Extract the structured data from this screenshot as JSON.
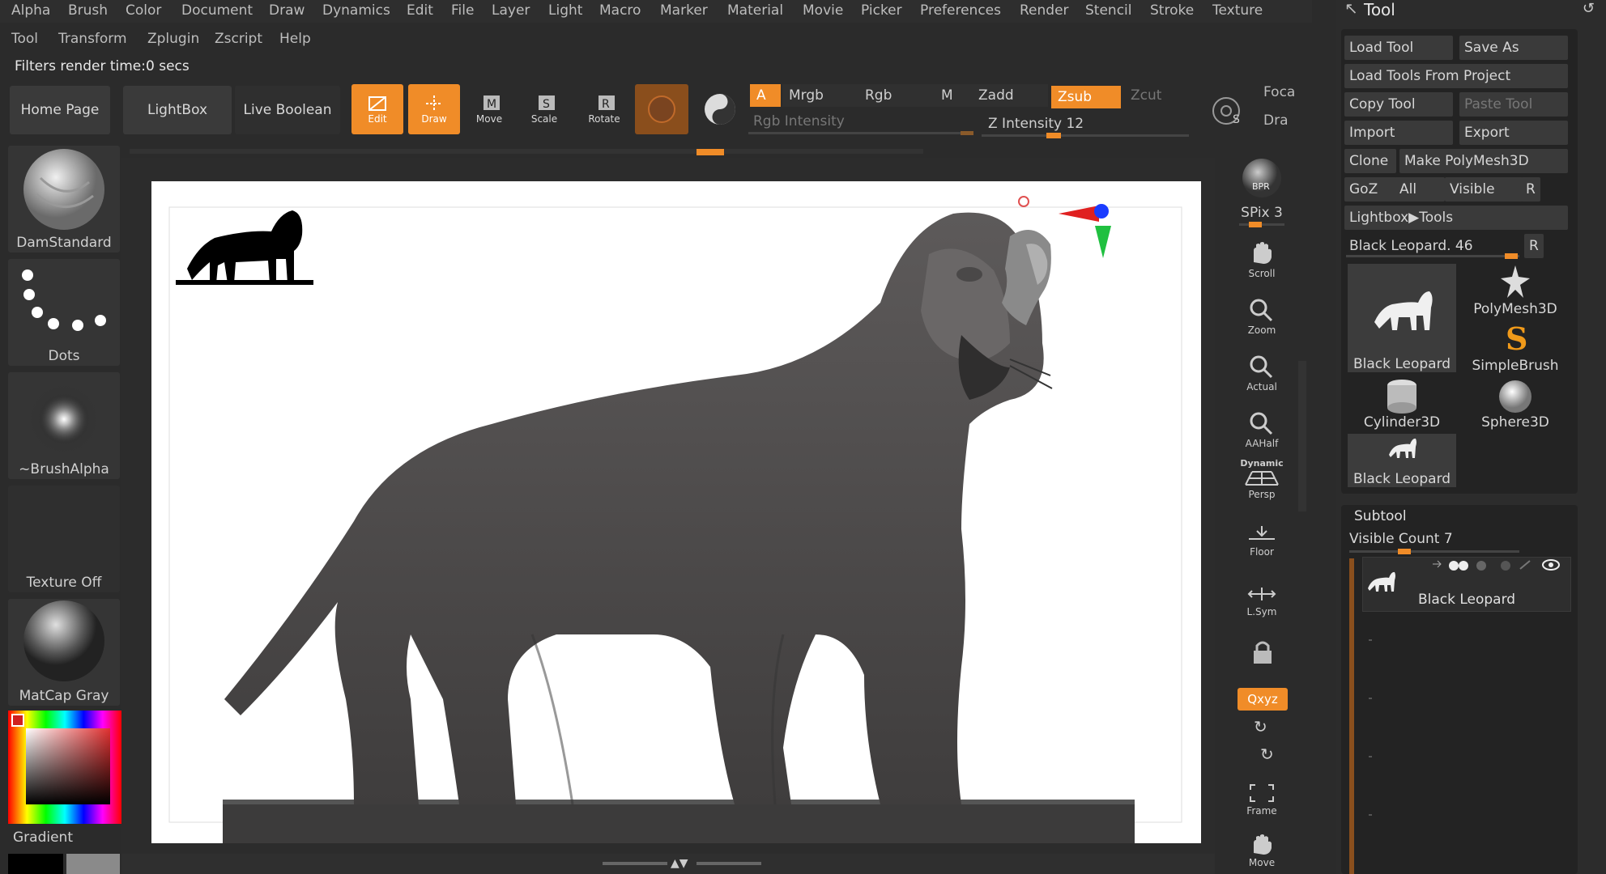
{
  "menu_primary": [
    "Alpha",
    "Brush",
    "Color",
    "Document",
    "Draw",
    "Dynamics",
    "Edit",
    "File",
    "Layer",
    "Light",
    "Macro",
    "Marker",
    "Material",
    "Movie",
    "Picker",
    "Preferences",
    "Render",
    "Stencil",
    "Stroke",
    "Texture"
  ],
  "menu_secondary": [
    "Tool",
    "Transform",
    "Zplugin",
    "Zscript",
    "Help"
  ],
  "status_text": "Filters render time:0 secs",
  "toolbar": {
    "home_page": "Home Page",
    "lightbox": "LightBox",
    "live_boolean": "Live Boolean",
    "edit": "Edit",
    "draw": "Draw",
    "move": "Move",
    "scale": "Scale",
    "rotate": "Rotate",
    "a": "A",
    "mrgb": "Mrgb",
    "rgb": "Rgb",
    "m": "M",
    "zadd": "Zadd",
    "zsub": "Zsub",
    "zcut": "Zcut",
    "rgb_intensity": "Rgb Intensity",
    "z_intensity": "Z Intensity 12",
    "focal": "Foca",
    "draw_size": "Dra",
    "accent": "#f08c28"
  },
  "left_shelf": {
    "brush": "DamStandard",
    "stroke": "Dots",
    "alpha": "~BrushAlpha",
    "texture": "Texture Off",
    "material": "MatCap Gray",
    "gradient": "Gradient"
  },
  "right_bar": {
    "bpr": "BPR",
    "spix": "SPix 3",
    "scroll": "Scroll",
    "zoom": "Zoom",
    "actual": "Actual",
    "aahalf": "AAHalf",
    "dynamic": "Dynamic",
    "persp": "Persp",
    "floor": "Floor",
    "lsym": "L.Sym",
    "xyz": "Qxyz",
    "frame": "Frame",
    "move": "Move"
  },
  "tool_panel": {
    "title": "Tool",
    "load_tool": "Load Tool",
    "save_as": "Save As",
    "load_from_project": "Load Tools From Project",
    "copy_tool": "Copy Tool",
    "paste_tool": "Paste Tool",
    "import": "Import",
    "export": "Export",
    "clone": "Clone",
    "make_polymesh": "Make PolyMesh3D",
    "goz": "GoZ",
    "all": "All",
    "visible": "Visible",
    "r": "R",
    "lightbox_tools": "Lightbox▶Tools",
    "current_tool": "Black Leopard. 46",
    "tools": [
      {
        "label": "Black Leopard"
      },
      {
        "label": "PolyMesh3D"
      },
      {
        "label": "SimpleBrush"
      },
      {
        "label": "Cylinder3D"
      },
      {
        "label": "Sphere3D"
      },
      {
        "label": "Black Leopard"
      }
    ],
    "subtool_title": "Subtool",
    "visible_count": "Visible Count 7",
    "subtool_item": "Black Leopard"
  }
}
